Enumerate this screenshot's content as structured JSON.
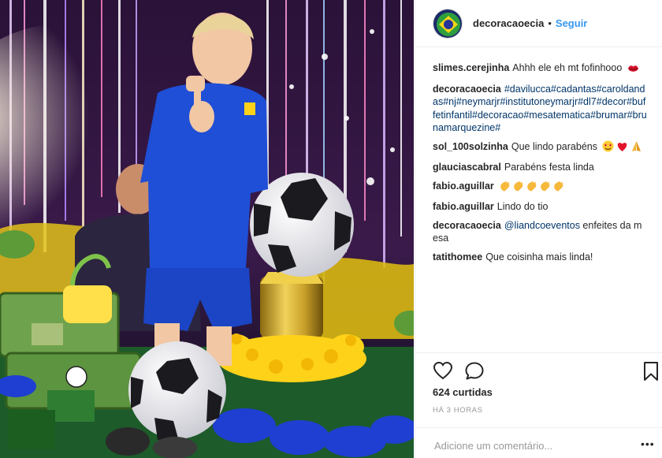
{
  "post": {
    "photo_alt": "",
    "account": {
      "username": "decoracaoecia",
      "separator": "•",
      "follow_label": "Seguir"
    },
    "comments": [
      {
        "user": "slimes.cerejinha",
        "text": "Ahhh ele eh mt fofinhooo",
        "emojis": [
          "lips"
        ],
        "is_tags": false
      },
      {
        "user": "decoracaoecia",
        "text": "#davilucca#cadantas#caroldandas#nj#neymarjr#institutoneymarjr#dl7#decor#buffetinfantil#decoracao#mesatematica#brumar#brunamarquezine#",
        "emojis": [],
        "is_tags": true
      },
      {
        "user": "sol_100solzinha",
        "text": "Que lindo parabéns",
        "emojis": [
          "heart-eyes",
          "red-heart",
          "folded-hands"
        ],
        "is_tags": false
      },
      {
        "user": "glauciascabral",
        "text": "Parabéns festa linda",
        "emojis": [],
        "is_tags": false
      },
      {
        "user": "fabio.aguillar",
        "text": "",
        "emojis": [
          "clap",
          "clap",
          "clap",
          "clap",
          "clap"
        ],
        "is_tags": false
      },
      {
        "user": "fabio.aguillar",
        "text": "Lindo do tio",
        "emojis": [],
        "is_tags": false
      },
      {
        "user": "decoracaoecia",
        "text": "@liandcoeventos",
        "text_after": " enfeites da mesa",
        "emojis": [],
        "is_tags": false,
        "has_mention": true
      },
      {
        "user": "tatithomee",
        "text": "Que coisinha mais linda!",
        "emojis": [],
        "is_tags": false
      }
    ],
    "actions": {
      "like_icon": "heart-outline-icon",
      "comment_icon": "speech-bubble-icon",
      "save_icon": "bookmark-icon"
    },
    "likes_label": "624 curtidas",
    "timestamp": "HÁ 3 HORAS",
    "add_comment": {
      "placeholder": "Adicione um comentário...",
      "more_label": "•••"
    },
    "colors": {
      "link": "#3897f0",
      "hashtag": "#003569",
      "muted": "#999999",
      "divider": "#efefef"
    }
  }
}
